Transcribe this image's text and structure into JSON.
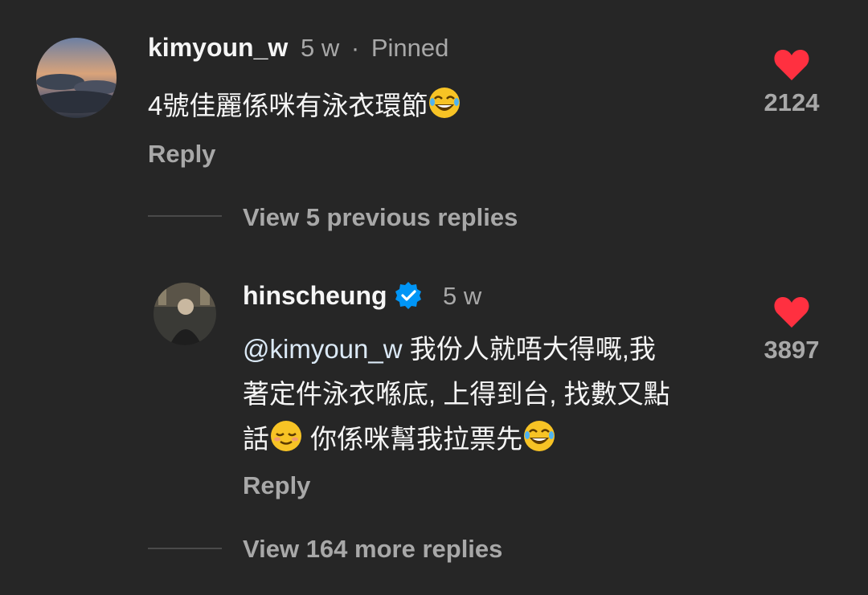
{
  "comments": [
    {
      "username": "kimyoun_w",
      "time": "5 w",
      "separator": "·",
      "pinned": "Pinned",
      "text": "4號佳麗係咪有泳衣環節",
      "emoji": "tears-of-joy",
      "likes": "2124",
      "reply_label": "Reply"
    },
    {
      "username": "hinscheung",
      "verified": true,
      "time": "5 w",
      "mention": "@kimyoun_w",
      "line1_rest": " 我份人就唔大得嘅,我",
      "line2": "著定件泳衣喺底, 上得到台, 找數又點",
      "line3_a": "話",
      "line3_b": " 你係咪幫我拉票先",
      "emoji_1": "relieved",
      "emoji_2": "tears-of-joy",
      "likes": "3897",
      "reply_label": "Reply"
    }
  ],
  "view_previous": "View 5 previous replies",
  "view_more": "View 164 more replies",
  "colors": {
    "background": "#262626",
    "heart": "#ff3040",
    "verified": "#0095f6",
    "secondary_text": "#a8a8a8"
  }
}
